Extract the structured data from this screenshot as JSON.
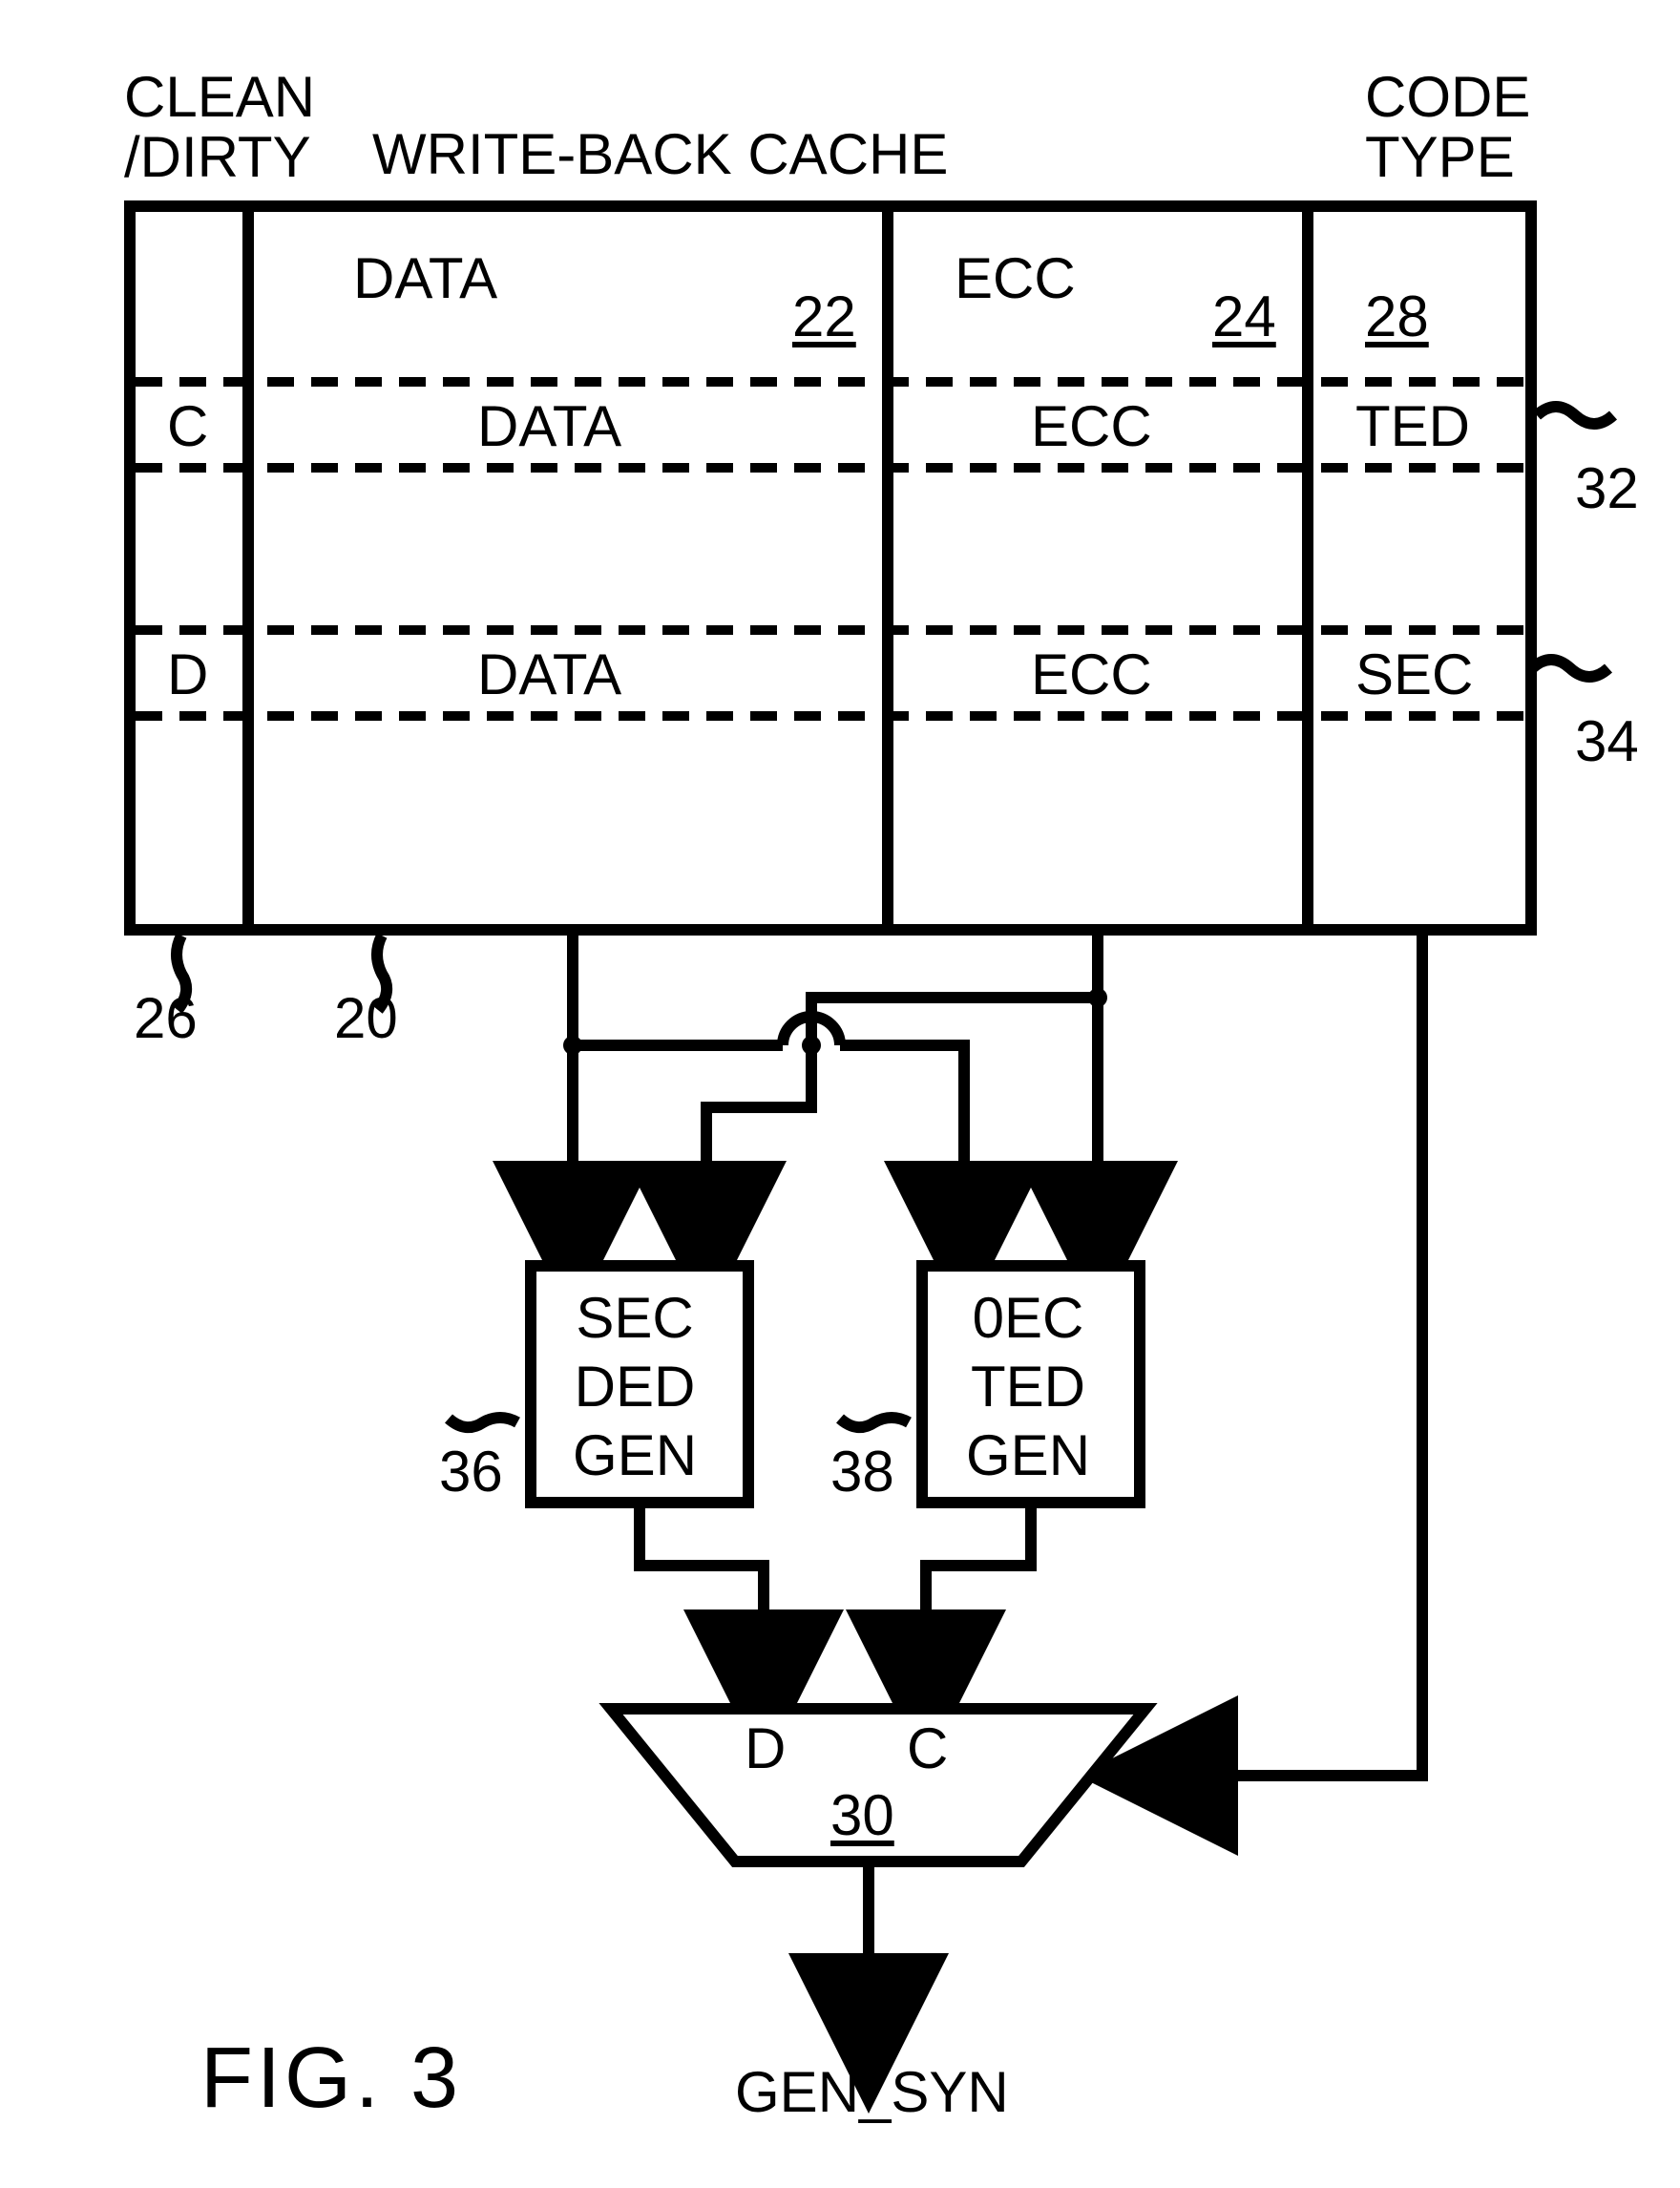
{
  "labels": {
    "clean_dirty": "CLEAN\n/DIRTY",
    "title": "WRITE-BACK CACHE",
    "code_type": "CODE\nTYPE"
  },
  "columns": {
    "data_header": "DATA",
    "data_header_ref": "22",
    "ecc_header": "ECC",
    "ecc_header_ref": "24",
    "codetype_header_ref": "28"
  },
  "rows": {
    "row1": {
      "cd": "C",
      "data": "DATA",
      "ecc": "ECC",
      "codetype": "TED"
    },
    "row2": {
      "cd": "D",
      "data": "DATA",
      "ecc": "ECC",
      "codetype": "SEC"
    }
  },
  "refs": {
    "r26": "26",
    "r20": "20",
    "r32": "32",
    "r34": "34",
    "r36": "36",
    "r38": "38",
    "r30": "30"
  },
  "blocks": {
    "sec_ded_gen": "SEC\nDED\nGEN",
    "oec_ted_gen": "0EC\nTED\nGEN"
  },
  "mux": {
    "left_in": "D",
    "right_in": "C"
  },
  "output": "GEN_SYN",
  "figure": "FIG. 3"
}
